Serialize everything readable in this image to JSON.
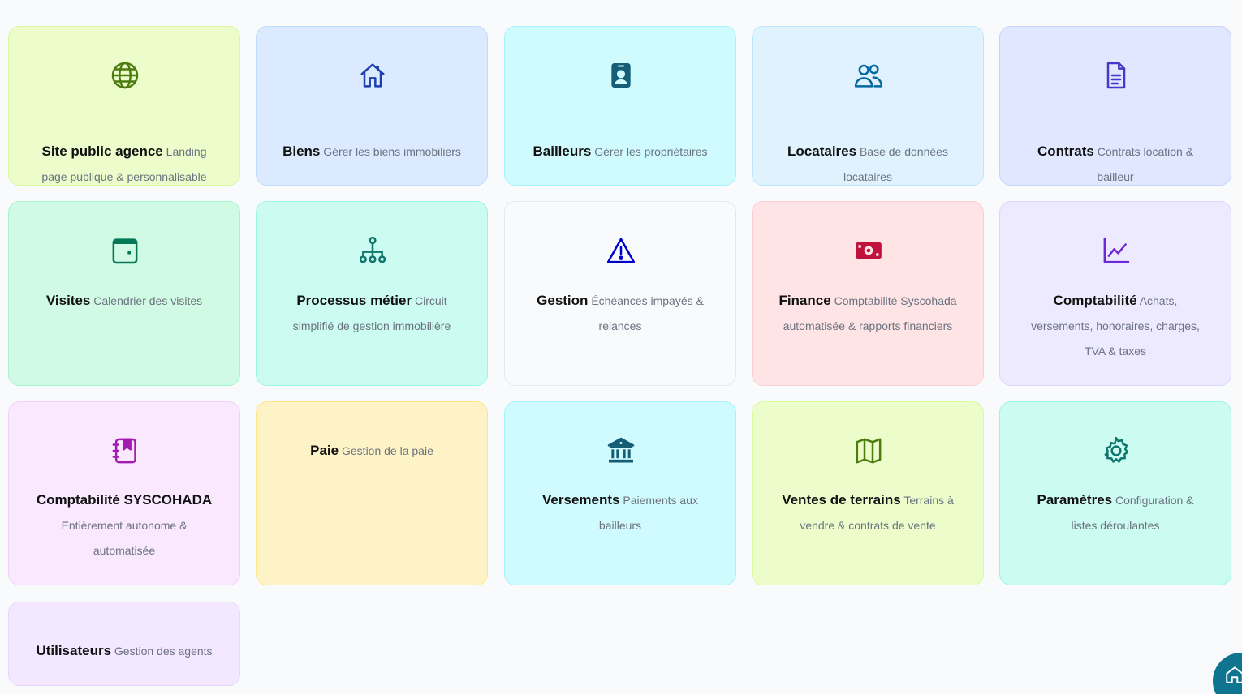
{
  "modules": [
    {
      "title": "Site public agence",
      "description": "Landing page publique & personnalisable",
      "icon": "globe-icon"
    },
    {
      "title": "Biens",
      "description": "Gérer les biens immobiliers",
      "icon": "house-icon"
    },
    {
      "title": "Bailleurs",
      "description": "Gérer les propriétaires",
      "icon": "id-badge-icon"
    },
    {
      "title": "Locataires",
      "description": "Base de données locataires",
      "icon": "users-icon"
    },
    {
      "title": "Contrats",
      "description": "Contrats location & bailleur",
      "icon": "document-icon"
    },
    {
      "title": "Visites",
      "description": "Calendrier des visites",
      "icon": "calendar-icon"
    },
    {
      "title": "Processus métier",
      "description": "Circuit simplifié de gestion immobilière",
      "icon": "org-chart-icon"
    },
    {
      "title": "Gestion",
      "description": "Échéances impayés & relances",
      "icon": "warning-icon"
    },
    {
      "title": "Finance",
      "description": "Comptabilité Syscohada automatisée & rapports financiers",
      "icon": "banknote-icon"
    },
    {
      "title": "Comptabilité",
      "description": "Achats, versements, honoraires, charges, TVA & taxes",
      "icon": "line-chart-icon"
    },
    {
      "title": "Comptabilité SYSCOHADA",
      "description": "Entièrement autonome & automatisée",
      "icon": "bookmark-book-icon"
    },
    {
      "title": "Paie",
      "description": "Gestion de la paie",
      "icon": ""
    },
    {
      "title": "Versements",
      "description": "Paiements aux bailleurs",
      "icon": "bank-icon"
    },
    {
      "title": "Ventes de terrains",
      "description": "Terrains à vendre & contrats de vente",
      "icon": "map-icon"
    },
    {
      "title": "Paramètres",
      "description": "Configuration & listes déroulantes",
      "icon": "gear-icon"
    },
    {
      "title": "Utilisateurs",
      "description": "Gestion des agents",
      "icon": ""
    }
  ],
  "colors": {
    "page_background": "#f8fafc",
    "card_backgrounds": [
      "#ecfccb",
      "#dbeafe",
      "#cffafe",
      "#e0f2fe",
      "#e0e7ff",
      "#d1fae5",
      "#ccfbf1",
      "#f8fafc",
      "#ffe4e6",
      "#ede9fe",
      "#fae8ff",
      "#fef3c7",
      "#cffafe",
      "#ecfccb",
      "#ccfbf1",
      "#f3e8ff"
    ],
    "card_borders": [
      "#d9f99d",
      "#bfdbfe",
      "#a5f3fc",
      "#bae6fd",
      "#c7d2fe",
      "#a7f3d0",
      "#99f6e4",
      "#e5e7eb",
      "#fecdd3",
      "#ddd6fe",
      "#f5d0fe",
      "#fde68a",
      "#a5f3fc",
      "#d9f99d",
      "#99f6e4",
      "#e9d5ff"
    ],
    "icon_colors": [
      "#4d7c0f",
      "#1e40af",
      "#155e75",
      "#0369a1",
      "#4338ca",
      "#047857",
      "#0f766e",
      "#0000cc",
      "#be123c",
      "#6d28d9",
      "#a21caf",
      "",
      "#155e75",
      "#4d7c0f",
      "#0f766e",
      ""
    ],
    "fab": "#0e7490"
  },
  "floating_button": {
    "icon": "home-icon"
  }
}
